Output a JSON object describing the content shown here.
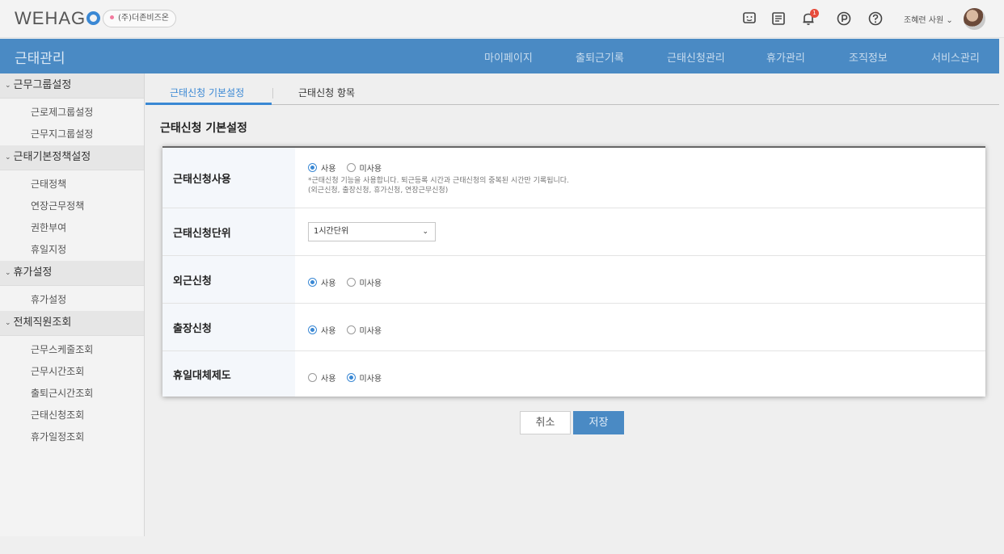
{
  "header": {
    "logo_text": "WEHAG",
    "company": "(주)더존비즈온",
    "notification_count": "1",
    "user_name": "조혜련 사원 ⌄"
  },
  "appbar": {
    "title": "근태관리",
    "nav": [
      "마이페이지",
      "출퇴근기록",
      "근태신청관리",
      "휴가관리",
      "조직정보",
      "서비스관리"
    ]
  },
  "sidebar": {
    "groups": [
      {
        "label": "근무그룹설정",
        "items": [
          "근로제그룹설정",
          "근무지그룹설정"
        ]
      },
      {
        "label": "근태기본정책설정",
        "items": [
          "근태정책",
          "연장근무정책",
          "권한부여",
          "휴일지정"
        ]
      },
      {
        "label": "휴가설정",
        "items": [
          "휴가설정"
        ]
      },
      {
        "label": "전체직원조회",
        "items": [
          "근무스케줄조회",
          "근무시간조회",
          "출퇴근시간조회",
          "근태신청조회",
          "휴가일정조회"
        ]
      }
    ]
  },
  "tabs": [
    "근태신청 기본설정",
    "근태신청 항목"
  ],
  "section_title": "근태신청 기본설정",
  "form": {
    "use_label": "사용",
    "unuse_label": "미사용",
    "rows": [
      {
        "label": "근태신청사용",
        "selected": "사용"
      },
      {
        "label": "근태신청단위",
        "select_value": "1시간단위"
      },
      {
        "label": "외근신청",
        "selected": "사용"
      },
      {
        "label": "출장신청",
        "selected": "사용"
      },
      {
        "label": "휴일대체제도",
        "selected": "미사용"
      }
    ],
    "description_line1": "*근태신청 기능을 사용합니다. 퇴근등록 시간과 근태신청의 중복된 시간만 기록됩니다.",
    "description_line2": "(외근신청, 출장신청, 휴가신청, 연장근무신청)"
  },
  "buttons": {
    "cancel": "취소",
    "save": "저장"
  },
  "colors": {
    "accent": "#4a8ac4",
    "link": "#3a88d4",
    "badge": "#e74c3c"
  }
}
